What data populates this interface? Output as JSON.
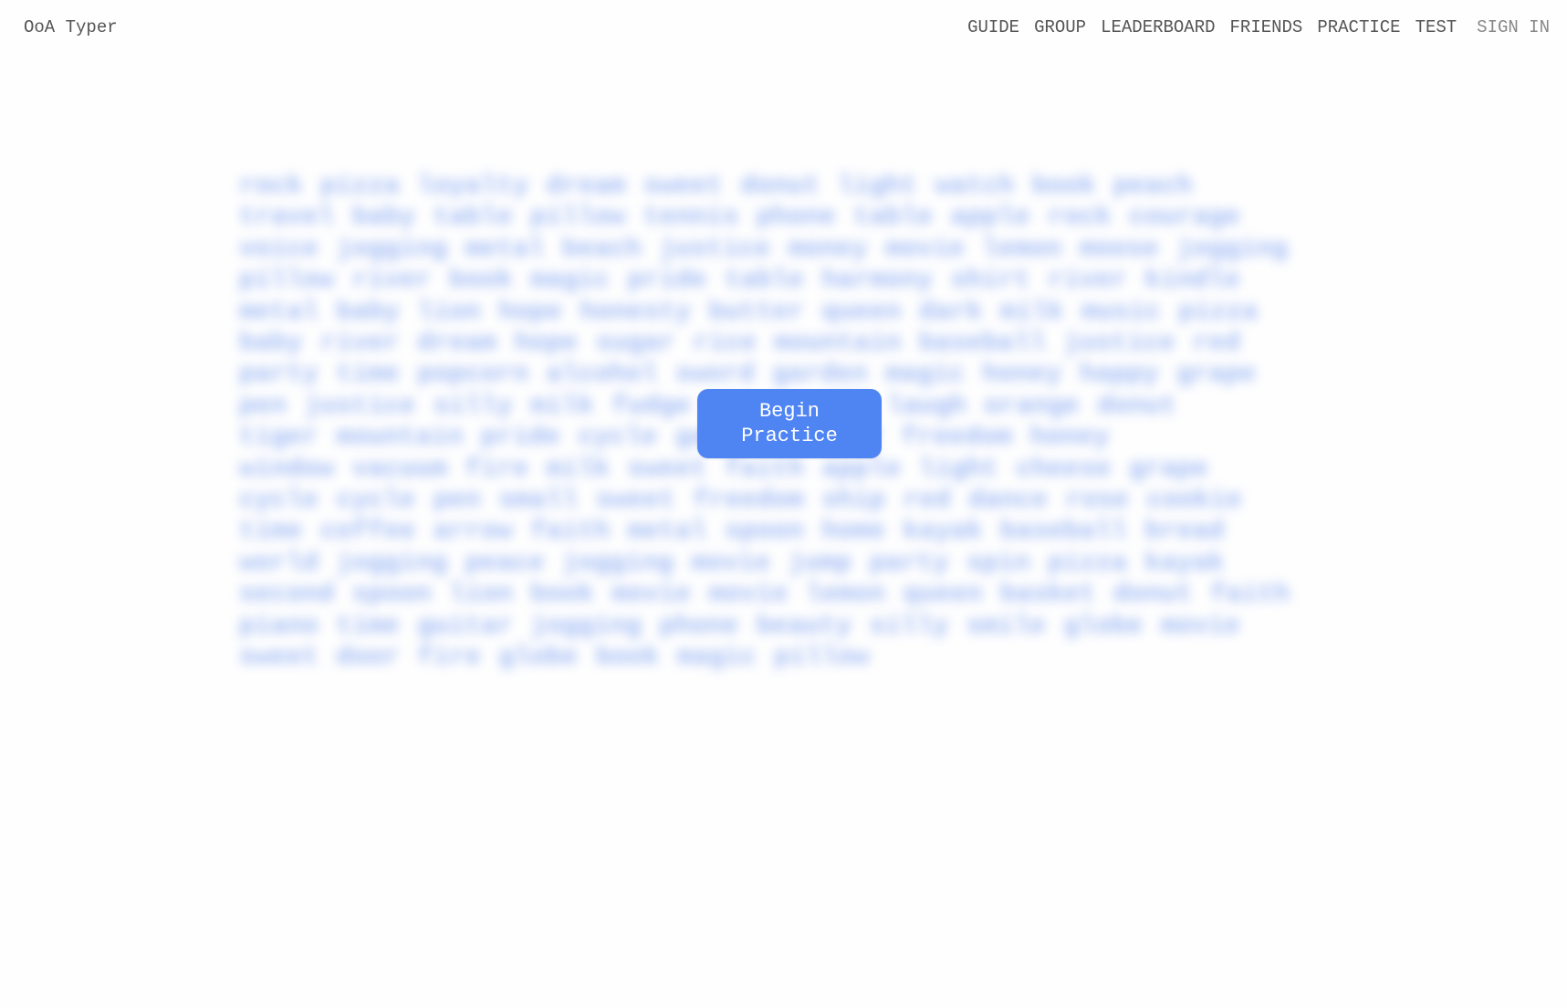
{
  "brand": "OoA Typer",
  "nav": {
    "items": [
      "GUIDE",
      "GROUP",
      "LEADERBOARD",
      "FRIENDS",
      "PRACTICE",
      "TEST"
    ],
    "sign_in": "SIGN IN"
  },
  "practice": {
    "button_label": "Begin Practice",
    "word_lines": [
      "rock pizza loyalty dream sweet donut light watch book peach",
      "travel baby table pillow tennis phone table apple rock courage",
      "voice jogging metal beach justice money movie lemon moose jogging",
      "pillow river book magic pride table harmony shirt river kindle",
      "metal baby lion hope honesty butter queen dark milk music pizza",
      "baby river dream hope sugar rice mountain baseball justice red",
      "party time popcorn alcohol sword garden magic honey happy grape",
      "pen justice silly milk fudge pizza milk laugh orange donut",
      "tiger mountain pride cycle garden butter freedom honey",
      "window vacuum fire milk sweet faith apple light cheese grape",
      "cycle cycle pen small sweet freedom ship red dance rose cookie",
      "time coffee arrow faith metal spoon home kayak baseball bread",
      "world jogging peace jogging movie jump party spin pizza kayak",
      "second spoon lion book movie movie lemon queen basket donut faith",
      "piano time guitar jogging phone beauty silly smile globe movie",
      "sweet door fire globe book magic pillow"
    ]
  },
  "colors": {
    "accent": "#4f84f3",
    "text_blur": "#4f80ee",
    "nav_text": "#555555",
    "sign_in_text": "#888888",
    "background": "#fefefe"
  }
}
